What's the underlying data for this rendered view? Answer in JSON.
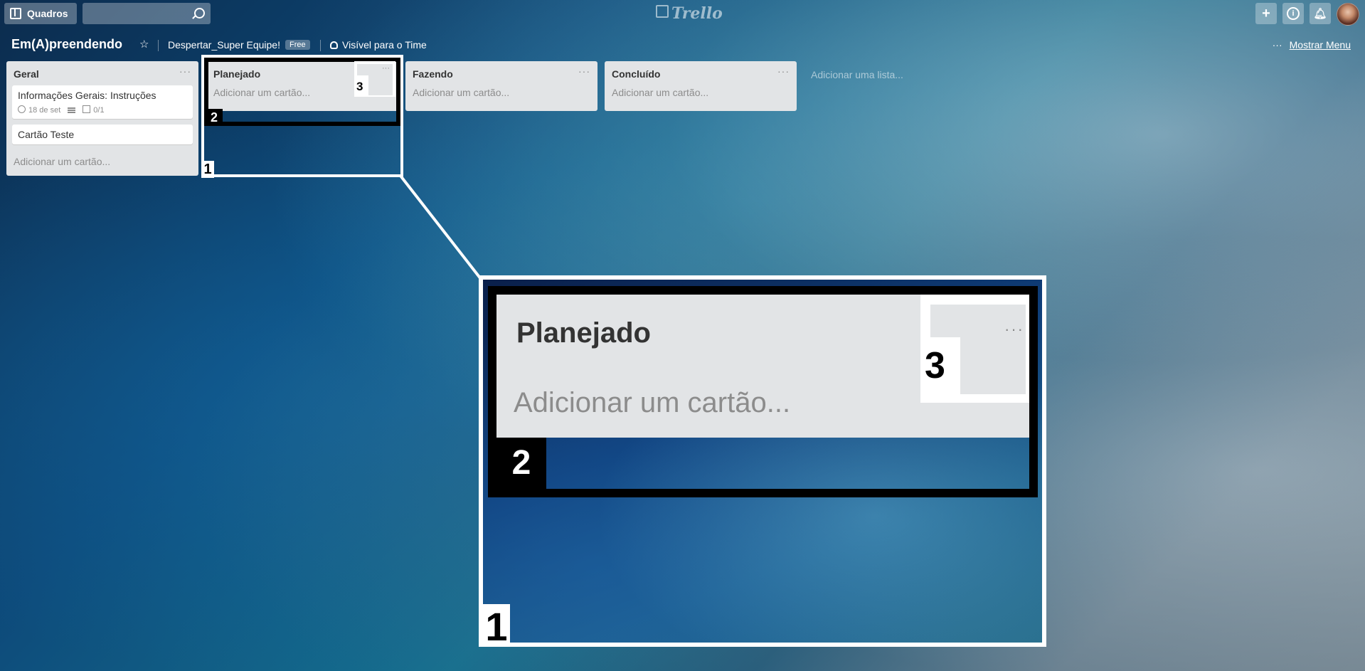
{
  "topbar": {
    "boards_label": "Quadros",
    "search_placeholder": "",
    "logo_text": "Trello",
    "add_icon": "plus-icon",
    "info_icon": "info-icon",
    "notifications_icon": "bell-icon"
  },
  "board": {
    "title": "Em(A)preendendo",
    "team": "Despertar_Super Equipe!",
    "plan_badge": "Free",
    "visibility": "Visível para o Time",
    "menu_dots": "···",
    "show_menu": "Mostrar Menu"
  },
  "lists": [
    {
      "title": "Geral",
      "menu": "···",
      "cards": [
        {
          "title": "Informações Gerais: Instruções",
          "due": "18 de set",
          "checklist": "0/1"
        },
        {
          "title": "Cartão Teste"
        }
      ],
      "add_card": "Adicionar um cartão..."
    },
    {
      "title": "Planejado",
      "menu": "···",
      "add_card": "Adicionar um cartão..."
    },
    {
      "title": "Fazendo",
      "menu": "···",
      "add_card": "Adicionar um cartão..."
    },
    {
      "title": "Concluído",
      "menu": "···",
      "add_card": "Adicionar um cartão..."
    }
  ],
  "add_list": "Adicionar uma lista...",
  "annotations": {
    "n1": "1",
    "n2": "2",
    "n3": "3"
  },
  "zoom": {
    "title": "Planejado",
    "add_card": "Adicionar um cartão...",
    "menu": "···",
    "n1": "1",
    "n2": "2",
    "n3": "3"
  },
  "colors": {
    "list_bg": "#e2e4e6",
    "annotation_black": "#000000",
    "annotation_white": "#ffffff"
  }
}
